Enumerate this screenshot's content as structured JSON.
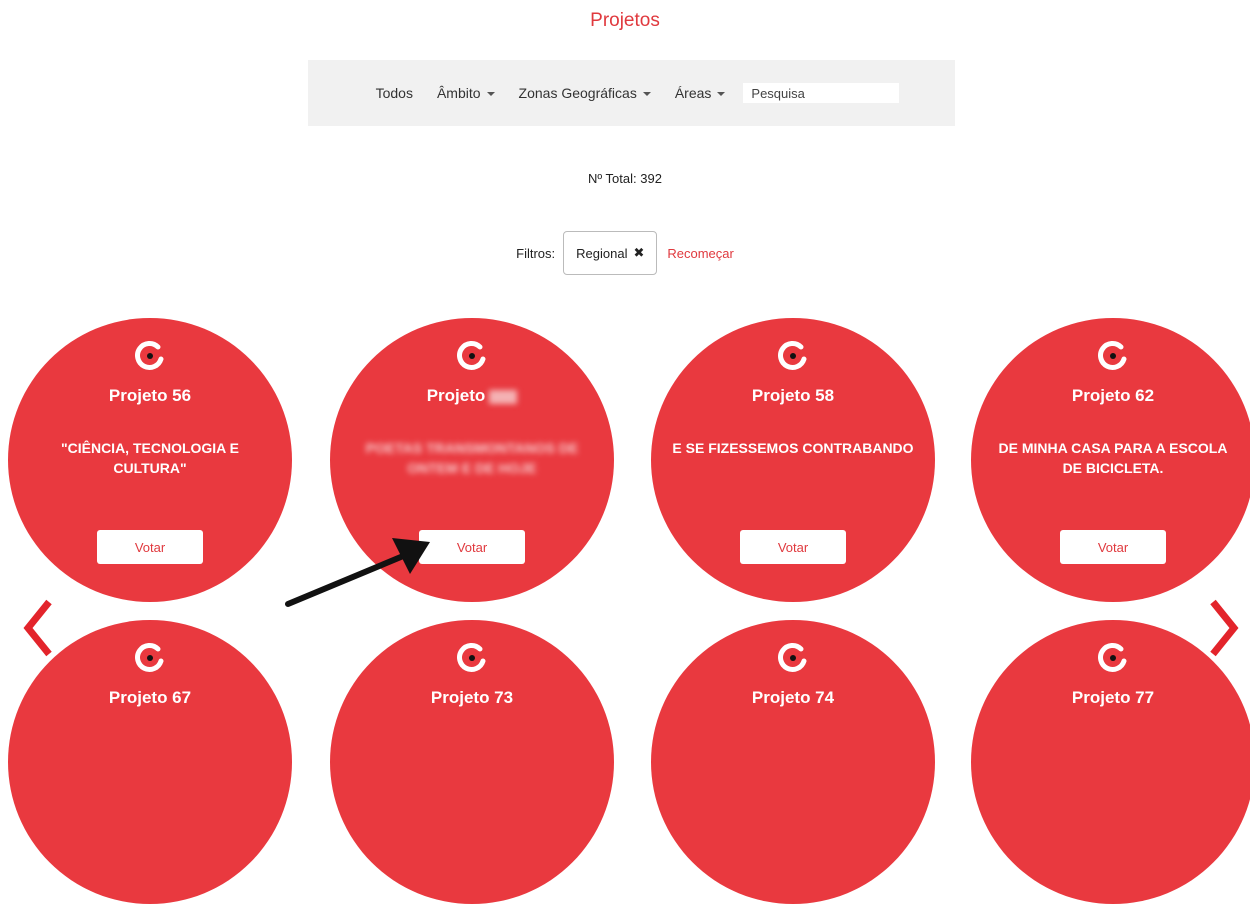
{
  "header": {
    "title": "Projetos"
  },
  "nav": {
    "items": [
      {
        "label": "Todos",
        "dropdown": false
      },
      {
        "label": "Âmbito",
        "dropdown": true
      },
      {
        "label": "Zonas Geográficas",
        "dropdown": true
      },
      {
        "label": "Áreas",
        "dropdown": true
      }
    ],
    "search_placeholder": "Pesquisa"
  },
  "total_label": "Nº Total: 392",
  "filters": {
    "label": "Filtros:",
    "chip": "Regional",
    "chip_remove": "✖",
    "reset": "Recomeçar"
  },
  "projects_row1": [
    {
      "title": "Projeto 56",
      "desc": "\"CIÊNCIA, TECNOLOGIA E CULTURA\"",
      "vote": "Votar"
    },
    {
      "title": "Projeto",
      "desc": "POETAS TRANSMONTANOS DE ONTEM E DE HOJE",
      "vote": "Votar"
    },
    {
      "title": "Projeto 58",
      "desc": "E SE FIZESSEMOS CONTRABANDO",
      "vote": "Votar"
    },
    {
      "title": "Projeto 62",
      "desc": "DE MINHA CASA PARA A ESCOLA DE BICICLETA.",
      "vote": "Votar"
    }
  ],
  "projects_row2": [
    {
      "title": "Projeto 67"
    },
    {
      "title": "Projeto 73"
    },
    {
      "title": "Projeto 74"
    },
    {
      "title": "Projeto 77"
    }
  ],
  "colors": {
    "accent": "#e9393f",
    "nav_bg": "#f1f1f1"
  },
  "icons": [
    "logo-icon",
    "chevron-left-icon",
    "chevron-right-icon",
    "close-icon",
    "caret-down-icon"
  ]
}
